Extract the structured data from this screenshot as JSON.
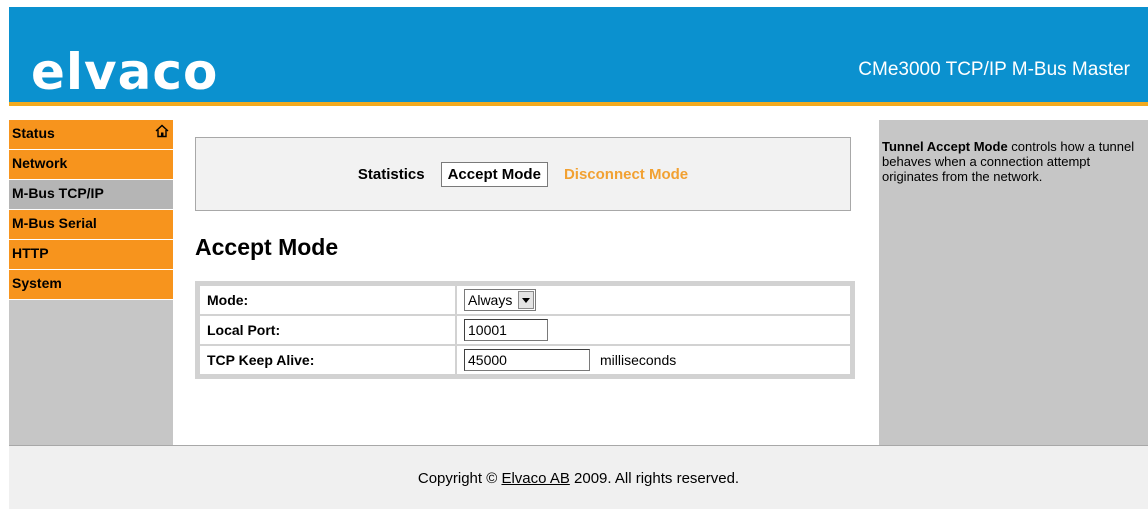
{
  "header": {
    "logo_text": "elvaco",
    "product_title": "CMe3000 TCP/IP M-Bus Master",
    "brand_blue": "#0b91cf",
    "brand_orange": "#f7941d"
  },
  "sidebar": {
    "items": [
      {
        "label": "Status",
        "icon": "home-icon",
        "active": false
      },
      {
        "label": "Network",
        "active": false
      },
      {
        "label": "M-Bus TCP/IP",
        "active": true
      },
      {
        "label": "M-Bus Serial",
        "active": false
      },
      {
        "label": "HTTP",
        "active": false
      },
      {
        "label": "System",
        "active": false
      }
    ]
  },
  "main": {
    "tabs": [
      {
        "label": "Statistics",
        "state": "normal"
      },
      {
        "label": "Accept Mode",
        "state": "selected"
      },
      {
        "label": "Disconnect Mode",
        "state": "link"
      }
    ],
    "heading": "Accept Mode",
    "form": {
      "mode_label": "Mode:",
      "mode_value": "Always",
      "local_port_label": "Local Port:",
      "local_port_value": "10001",
      "keepalive_label": "TCP Keep Alive:",
      "keepalive_value": "45000",
      "keepalive_unit": "milliseconds"
    }
  },
  "help": {
    "bold": "Tunnel Accept Mode",
    "text": " controls how a tunnel behaves when a connection attempt originates from the network."
  },
  "footer": {
    "prefix": "Copyright © ",
    "link": "Elvaco AB",
    "suffix": " 2009. All rights reserved."
  }
}
